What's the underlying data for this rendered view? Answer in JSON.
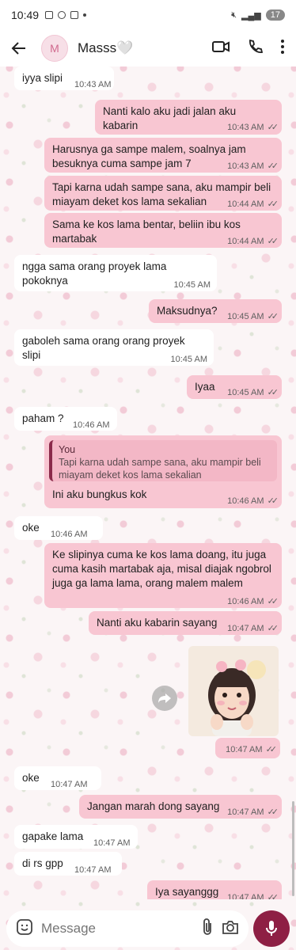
{
  "status_bar": {
    "time": "10:49",
    "battery": "17"
  },
  "header": {
    "avatar_letter": "M",
    "contact_name": "Masss🤍"
  },
  "messages": [
    {
      "text": "iyya slipi",
      "time": "10:43 AM"
    },
    {
      "text": "Nanti kalo aku jadi jalan aku kabarin",
      "time": "10:43 AM"
    },
    {
      "text": "Harusnya ga sampe malem, soalnya jam besuknya cuma sampe jam 7",
      "time": "10:43 AM"
    },
    {
      "text": "Tapi karna udah sampe sana, aku mampir beli miayam deket kos lama sekalian",
      "time": "10:44 AM"
    },
    {
      "text": "Sama ke kos lama bentar, beliin ibu kos martabak",
      "time": "10:44 AM"
    },
    {
      "text": "ngga sama orang proyek lama pokoknya",
      "time": "10:45 AM"
    },
    {
      "text": "Maksudnya?",
      "time": "10:45 AM"
    },
    {
      "text": "gaboleh sama orang orang proyek slipi",
      "time": "10:45 AM"
    },
    {
      "text": "Iyaa",
      "time": "10:45 AM"
    },
    {
      "text": "paham ?",
      "time": "10:46 AM"
    },
    {
      "quote_author": "You",
      "quote_text": "Tapi karna udah sampe sana, aku mampir beli miayam deket kos lama sekalian",
      "text": "Ini aku bungkus kok",
      "time": "10:46 AM"
    },
    {
      "text": "oke",
      "time": "10:46 AM"
    },
    {
      "text": "Ke slipinya cuma ke kos lama doang, itu juga cuma kasih martabak aja, misal diajak ngobrol juga ga lama lama, orang malem malem",
      "time": "10:46 AM"
    },
    {
      "text": "Nanti aku kabarin sayang",
      "time": "10:47 AM"
    },
    {
      "image": "girl-photo",
      "time": "10:47 AM"
    },
    {
      "text": "oke",
      "time": "10:47 AM"
    },
    {
      "text": "Jangan marah dong sayang",
      "time": "10:47 AM"
    },
    {
      "text": "gapake lama",
      "time": "10:47 AM"
    },
    {
      "text": "di rs gpp",
      "time": "10:47 AM"
    },
    {
      "text": "Iya sayanggg",
      "time": "10:47 AM"
    }
  ],
  "input": {
    "placeholder": "Message"
  },
  "colors": {
    "outgoing_bubble": "#f8c6d2",
    "incoming_bubble": "#ffffff",
    "mic_button": "#8e1f44",
    "read_ticks": "#606060"
  },
  "icons": [
    "back-arrow-icon",
    "video-call-icon",
    "phone-icon",
    "more-options-icon",
    "sticker-icon",
    "attach-icon",
    "camera-icon",
    "mic-icon",
    "forward-icon"
  ]
}
